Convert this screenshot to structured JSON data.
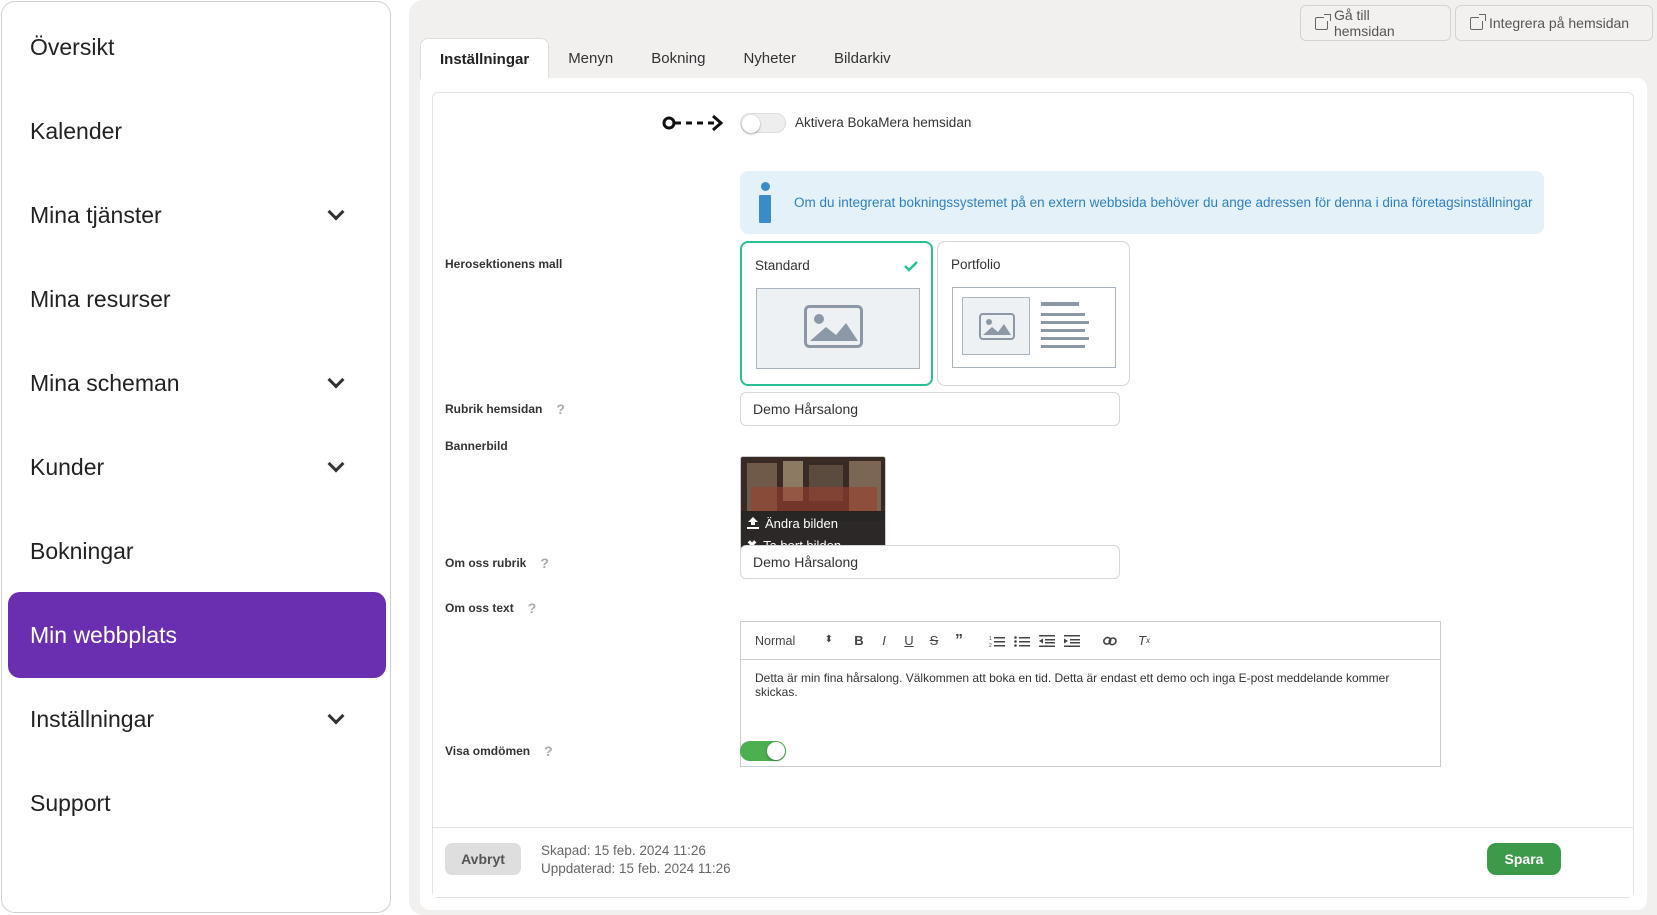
{
  "sidebar": {
    "items": [
      {
        "label": "Översikt",
        "has_chevron": false,
        "active": false
      },
      {
        "label": "Kalender",
        "has_chevron": false,
        "active": false
      },
      {
        "label": "Mina tjänster",
        "has_chevron": true,
        "active": false
      },
      {
        "label": "Mina resurser",
        "has_chevron": false,
        "active": false
      },
      {
        "label": "Mina scheman",
        "has_chevron": true,
        "active": false
      },
      {
        "label": "Kunder",
        "has_chevron": true,
        "active": false
      },
      {
        "label": "Bokningar",
        "has_chevron": false,
        "active": false
      },
      {
        "label": "Min webbplats",
        "has_chevron": false,
        "active": true
      },
      {
        "label": "Inställningar",
        "has_chevron": true,
        "active": false
      },
      {
        "label": "Support",
        "has_chevron": false,
        "active": false
      }
    ]
  },
  "header": {
    "goto_site_label": "Gå till hemsidan",
    "integrate_label": "Integrera på hemsidan"
  },
  "tabs": [
    {
      "label": "Inställningar",
      "active": true
    },
    {
      "label": "Menyn",
      "active": false
    },
    {
      "label": "Bokning",
      "active": false
    },
    {
      "label": "Nyheter",
      "active": false
    },
    {
      "label": "Bildarkiv",
      "active": false
    }
  ],
  "form": {
    "activate_label": "Aktivera BokaMera hemsidan",
    "activate_on": false,
    "info_text": "Om du integrerat bokningssystemet på en extern webbsida behöver du ange adressen för denna i dina företagsinställningar",
    "hero_label": "Herosektionens mall",
    "templates": [
      {
        "name": "Standard",
        "selected": true
      },
      {
        "name": "Portfolio",
        "selected": false
      }
    ],
    "title_label": "Rubrik hemsidan",
    "title_value": "Demo Hårsalong",
    "banner_label": "Bannerbild",
    "banner_change": "Ändra bilden",
    "banner_remove": "Ta bort bilden",
    "about_title_label": "Om oss rubrik",
    "about_title_value": "Demo Hårsalong",
    "about_text_label": "Om oss text",
    "editor_format": "Normal",
    "about_text_value": "Detta är min fina hårsalong. Välkommen att boka en tid. Detta är endast ett demo och inga E-post meddelande kommer skickas.",
    "reviews_label": "Visa omdömen",
    "reviews_on": true
  },
  "footer": {
    "cancel_label": "Avbryt",
    "save_label": "Spara",
    "created": "Skapad: 15 feb. 2024 11:26",
    "updated": "Uppdaterad: 15 feb. 2024 11:26"
  },
  "colors": {
    "accent_purple": "#6a2fb0",
    "success_green": "#3d9a4b",
    "selected_teal": "#2bbf95",
    "info_blue": "#2f7fbf"
  }
}
